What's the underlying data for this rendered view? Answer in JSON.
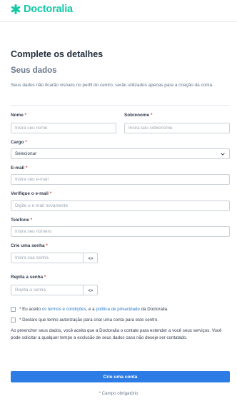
{
  "brand": {
    "name": "Doctoralia",
    "color": "#13c9a5"
  },
  "form": {
    "title": "Complete os detalhes",
    "subtitle": "Seus dados",
    "description": "Seus dados não ficarão visíveis no perfil do centro, serão utilizados apenas para a criação da conta.",
    "required_mark": "*",
    "fields": {
      "nome": {
        "label": "Nome",
        "placeholder": "Insira seu nome"
      },
      "sobrenome": {
        "label": "Sobrenome",
        "placeholder": "Insira seu sobrenome"
      },
      "cargo": {
        "label": "Cargo",
        "value": "Selecionar"
      },
      "email": {
        "label": "E-mail",
        "placeholder": "Insira seu e-mail"
      },
      "email_verify": {
        "label": "Verifique o e-mail",
        "placeholder": "Digite o e-mail novamente"
      },
      "telefone": {
        "label": "Telefone",
        "placeholder": "Insira seu número"
      },
      "senha": {
        "label": "Crie uma senha",
        "placeholder": "Insira sua senha"
      },
      "senha_repeat": {
        "label": "Repita a senha",
        "placeholder": "Repita a senha"
      }
    },
    "terms": {
      "prefix": "* Eu aceito ",
      "terms_link": "os termos e condições",
      "middle": ", e a ",
      "privacy_link": "política de privacidade",
      "suffix": " da Doctoralia."
    },
    "authorization": "* Declaro que tenho autorização para criar uma conta para este centro.",
    "consent": "Ao preencher seus dados, você aceita que a Doctoralia o contate para estender a você seus serviços. Você pode solicitar a qualquer tempo a exclusão de seus dados caso não deseje ser contatado.",
    "submit_label": "Crie uma conta",
    "footnote": "* Campo obrigatório"
  },
  "colors": {
    "primary": "#2d7ce6",
    "link": "#2a7cc7",
    "required": "#e04c3b"
  }
}
